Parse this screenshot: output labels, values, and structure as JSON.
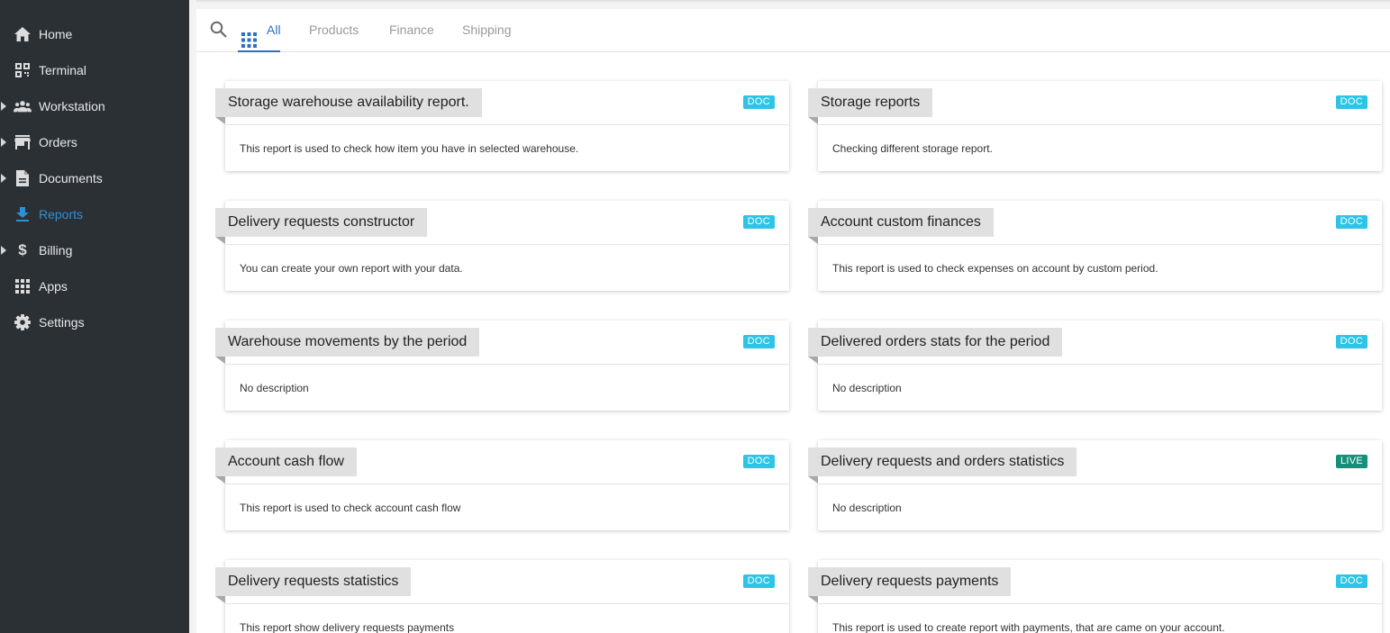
{
  "sidebar": {
    "items": [
      {
        "label": "Home",
        "icon": "home-icon",
        "expandable": false,
        "active": false
      },
      {
        "label": "Terminal",
        "icon": "qr-code-icon",
        "expandable": false,
        "active": false
      },
      {
        "label": "Workstation",
        "icon": "people-icon",
        "expandable": true,
        "active": false
      },
      {
        "label": "Orders",
        "icon": "store-icon",
        "expandable": true,
        "active": false
      },
      {
        "label": "Documents",
        "icon": "document-icon",
        "expandable": true,
        "active": false
      },
      {
        "label": "Reports",
        "icon": "download-icon",
        "expandable": false,
        "active": true
      },
      {
        "label": "Billing",
        "icon": "dollar-icon",
        "expandable": true,
        "active": false
      },
      {
        "label": "Apps",
        "icon": "apps-grid-icon",
        "expandable": false,
        "active": false
      },
      {
        "label": "Settings",
        "icon": "gear-icon",
        "expandable": false,
        "active": false
      }
    ]
  },
  "tabs": {
    "items": [
      {
        "label": "All",
        "active": true
      },
      {
        "label": "Products",
        "active": false
      },
      {
        "label": "Finance",
        "active": false
      },
      {
        "label": "Shipping",
        "active": false
      }
    ]
  },
  "badges": {
    "doc_color": "#2ec4e6",
    "live_color": "#138f7a"
  },
  "reports": [
    {
      "title": "Storage warehouse availability report.",
      "badge": "DOC",
      "description": "This report is used to check how item you have in selected warehouse."
    },
    {
      "title": "Storage reports",
      "badge": "DOC",
      "description": "Checking different storage report."
    },
    {
      "title": "Delivery requests constructor",
      "badge": "DOC",
      "description": "You can create your own report with your data."
    },
    {
      "title": "Account custom finances",
      "badge": "DOC",
      "description": "This report is used to check expenses on account by custom period."
    },
    {
      "title": "Warehouse movements by the period",
      "badge": "DOC",
      "description": "No description"
    },
    {
      "title": "Delivered orders stats for the period",
      "badge": "DOC",
      "description": "No description"
    },
    {
      "title": "Account cash flow",
      "badge": "DOC",
      "description": "This report is used to check account cash flow"
    },
    {
      "title": "Delivery requests and orders statistics",
      "badge": "LIVE",
      "description": "No description"
    },
    {
      "title": "Delivery requests statistics",
      "badge": "DOC",
      "description": "This report show delivery requests payments"
    },
    {
      "title": "Delivery requests payments",
      "badge": "DOC",
      "description": "This report is used to create report with payments, that are came on your account."
    }
  ]
}
